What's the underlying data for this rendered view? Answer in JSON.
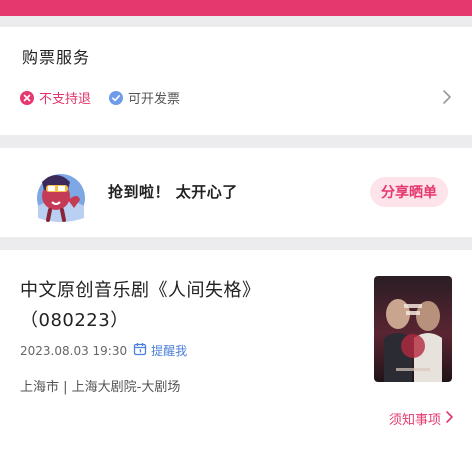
{
  "colors": {
    "accent": "#e5386e",
    "link_blue": "#4b7fd8",
    "share_bg": "#fde3ea"
  },
  "service": {
    "title": "购票服务",
    "tags": [
      {
        "icon": "x-circle-icon",
        "label": "不支持退"
      },
      {
        "icon": "check-circle-icon",
        "label": "可开发票"
      }
    ]
  },
  "share": {
    "message": "抢到啦！ 太开心了",
    "button_label": "分享晒单"
  },
  "event": {
    "title": "中文原创音乐剧《人间失格》（080223）",
    "datetime": "2023.08.03 19:30",
    "remind_label": "提醒我",
    "venue": "上海市 | 上海大剧院-大剧场",
    "notice_label": "须知事项"
  }
}
